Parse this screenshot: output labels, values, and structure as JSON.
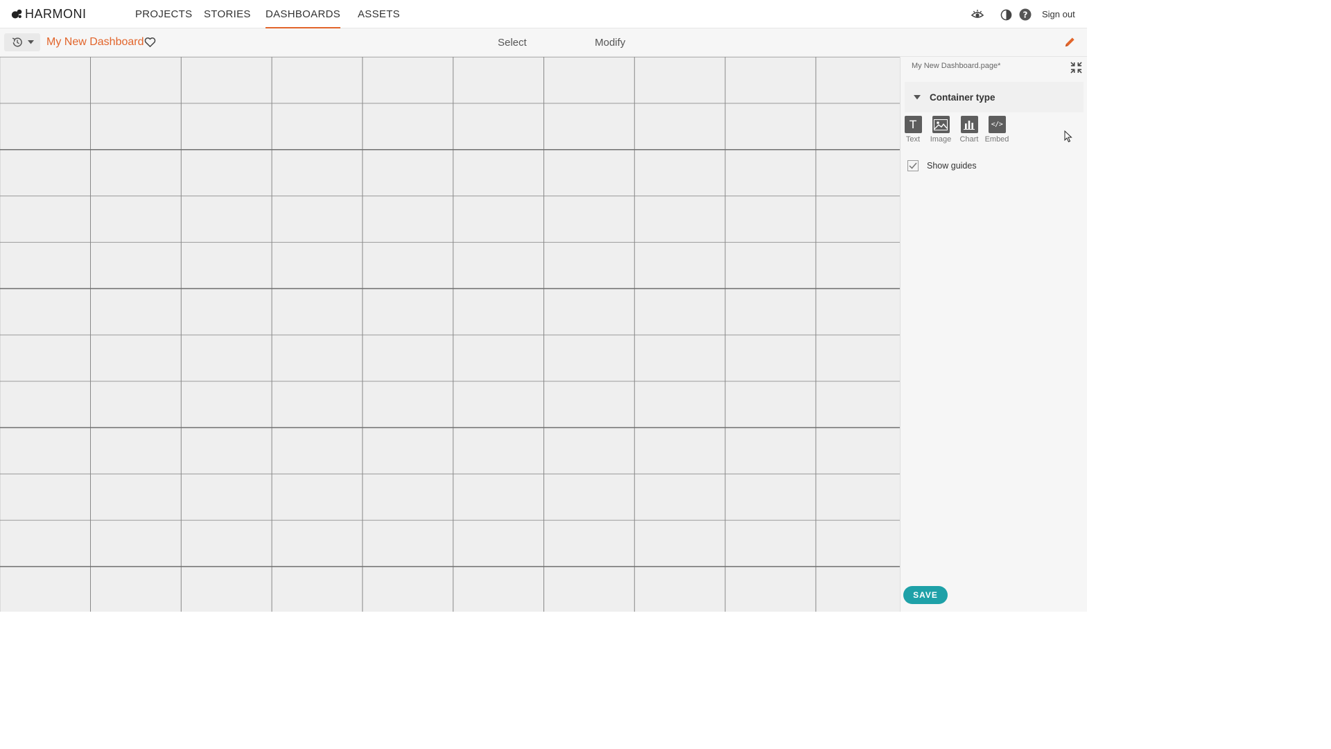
{
  "app": {
    "name": "HARMONI"
  },
  "nav": {
    "tabs": [
      {
        "label": "PROJECTS",
        "active": false
      },
      {
        "label": "STORIES",
        "active": false
      },
      {
        "label": "DASHBOARDS",
        "active": true
      },
      {
        "label": "ASSETS",
        "active": false
      }
    ],
    "sign_out": "Sign out",
    "icons": [
      "eye-icon",
      "contrast-icon",
      "help-icon"
    ]
  },
  "toolbar": {
    "dashboard_title": "My New Dashboard",
    "modes": [
      "Select",
      "Modify"
    ],
    "icons": [
      "history-icon",
      "heart-icon",
      "pencil-icon"
    ]
  },
  "panel": {
    "file_name": "My New Dashboard.page*",
    "section_title": "Container type",
    "container_types": [
      {
        "label": "Text",
        "icon": "text-icon"
      },
      {
        "label": "Image",
        "icon": "image-icon"
      },
      {
        "label": "Chart",
        "icon": "chart-icon"
      },
      {
        "label": "Embed",
        "icon": "embed-icon"
      }
    ],
    "show_guides_label": "Show guides",
    "show_guides_checked": true,
    "save_label": "SAVE"
  },
  "colors": {
    "accent": "#e2652b",
    "save": "#1ea1a8",
    "canvas": "#efefef",
    "panel": "#f6f6f6"
  }
}
